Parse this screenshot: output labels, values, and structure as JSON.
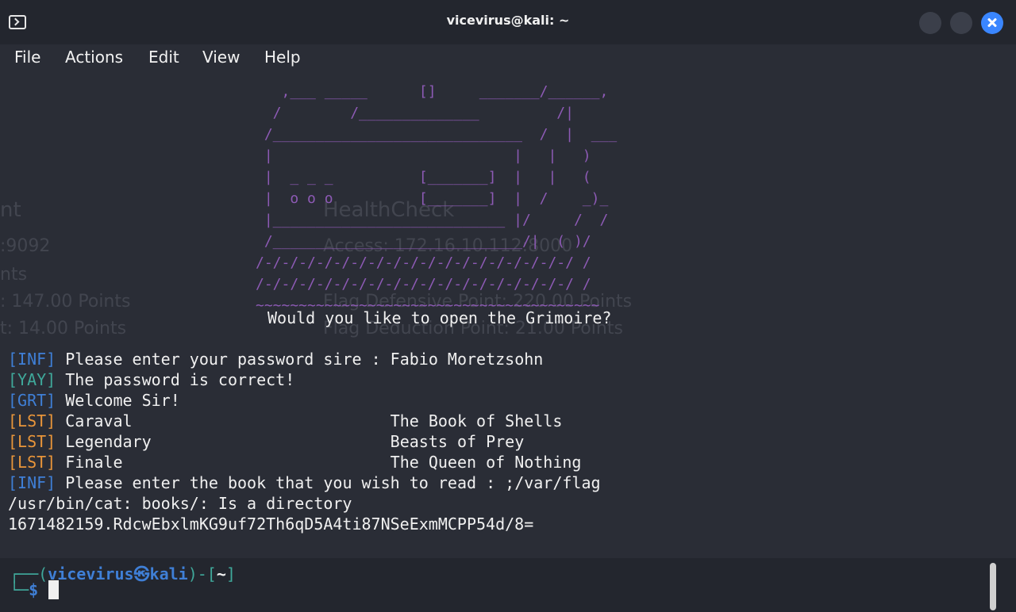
{
  "window": {
    "title": "vicevirus@kali: ~",
    "icon": "terminal-icon"
  },
  "menu": [
    "File",
    "Actions",
    "Edit",
    "View",
    "Help"
  ],
  "ghost": {
    "healthcheck": "HealthCheck",
    "access": "Access: 172.16.10.112:8000",
    "flag_def": "Flag Defensive Point: 220.00 Points",
    "flag_ded": "Flag Deduction Point: 21.00 Points",
    "left_nt": "nt",
    "left_port": ":9092",
    "left_nts": "nts",
    "left_147": ": 147.00 Points",
    "left_14": "t: 14.00 Points"
  },
  "ascii_art": "   ,___ _____      []     _______/______,\n  /        /______________         /|\n /_____________________________  /  |  ___\n |                            |   |   )\n |  _ _ _          [_______]  |   |   (\n |  o o o          [_______]  |  /    _)_\n |___________________________ |/     /  /\n /_____________________________/|  ( )/\n/-/-/-/-/-/-/-/-/-/-/-/-/-/-/-/-/-/-/ /\n/-/-/-/-/-/-/-/-/-/-/-/-/-/-/-/-/-/-/ /\n~~~~~~~~~~~~~~~~~~~~~~~~~~~~~~~~~~~~~~~~",
  "ascii_prompt": "Would you like to open the Grimoire?",
  "output": [
    {
      "tag": "[INF]",
      "cls": "tag-inf",
      "text": " Please enter your password sire : Fabio Moretzsohn"
    },
    {
      "tag": "[YAY]",
      "cls": "tag-yay",
      "text": " The password is correct!"
    },
    {
      "tag": "[GRT]",
      "cls": "tag-grt",
      "text": " Welcome Sir!"
    },
    {
      "tag": "[LST]",
      "cls": "tag-lst",
      "text": " Caraval                           The Book of Shells"
    },
    {
      "tag": "[LST]",
      "cls": "tag-lst",
      "text": " Legendary                         Beasts of Prey"
    },
    {
      "tag": "[LST]",
      "cls": "tag-lst",
      "text": " Finale                            The Queen of Nothing"
    },
    {
      "tag": "[INF]",
      "cls": "tag-inf",
      "text": " Please enter the book that you wish to read : ;/var/flag"
    },
    {
      "tag": "",
      "cls": "",
      "text": "/usr/bin/cat: books/: Is a directory"
    },
    {
      "tag": "",
      "cls": "",
      "text": "1671482159.RdcwEbxlmKG9uf72Th6qD5A4ti87NSeExmMCPP54d/8="
    }
  ],
  "prompt": {
    "open": "┌──(",
    "user": "vicevirus",
    "at": "㉿",
    "host": "kali",
    "close": ")-[",
    "dir": "~",
    "end": "]",
    "line2_prefix": "└─",
    "dollar": "$"
  }
}
